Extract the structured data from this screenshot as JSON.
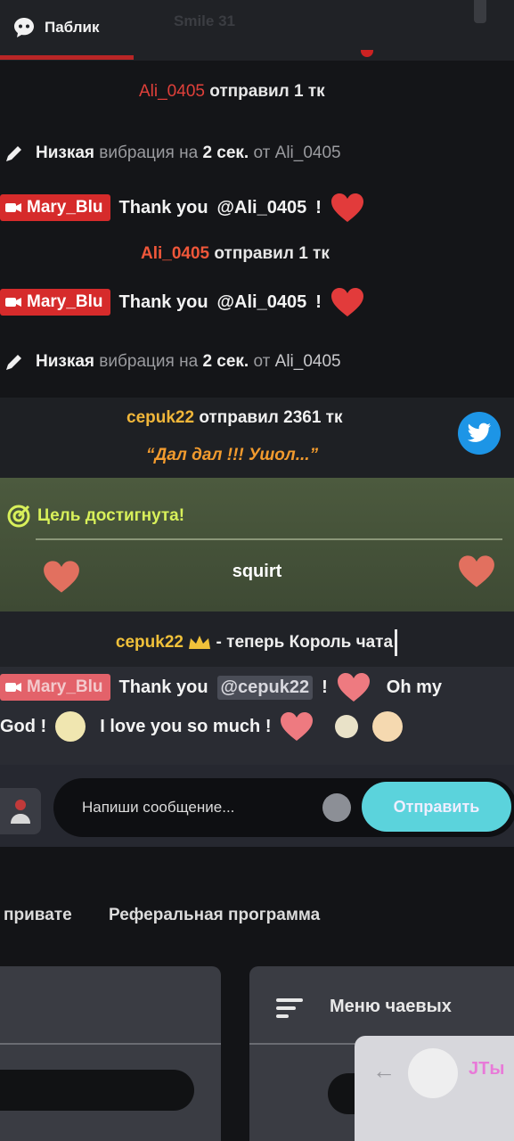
{
  "header": {
    "tab_public_label": "Паблик",
    "tab_ghost_label": "Smile 31"
  },
  "chat": {
    "tip_1": {
      "user": "Ali_0405",
      "text": "отправил 1 тк"
    },
    "vibration_1": {
      "level": "Низкая",
      "middle": "вибрация на",
      "duration": "2 сек.",
      "from": "от",
      "user": "Ali_0405"
    },
    "reply_1": {
      "badge": "Mary_Blu",
      "text": "Thank you",
      "mention": "@Ali_0405",
      "end": "!"
    },
    "tip_2": {
      "user": "Ali_0405",
      "text": "отправил 1 тк"
    },
    "reply_2": {
      "badge": "Mary_Blu",
      "text": "Thank you",
      "mention": "@Ali_0405",
      "end": "!"
    },
    "vibration_2": {
      "level": "Низкая",
      "middle": "вибрация на",
      "duration": "2 сек.",
      "from": "от",
      "user": "Ali_0405"
    }
  },
  "big_tip": {
    "user": "cepuk22",
    "text": "отправил 2361 тк",
    "quote": "“Дал дал !!! Ушол...”"
  },
  "goal": {
    "title": "Цель достигнута!",
    "label": "squirt"
  },
  "king": {
    "user": "cepuk22",
    "text": "- теперь Король чата"
  },
  "last_message": {
    "badge": "Mary_Blu",
    "text1": "Thank you",
    "mention": "@cepuk22",
    "end": "!",
    "text2": "Oh my",
    "line2_start": "God !",
    "line2_mid": "I love you so much !"
  },
  "composer": {
    "placeholder": "Напиши сообщение...",
    "send_label": "Отправить"
  },
  "bottom_nav": {
    "item1": "привате",
    "item2": "Реферальная программа",
    "tip_menu_label": "Меню чаевых",
    "popup_text": "JTы"
  },
  "colors": {
    "badge_red": "#d62b2b",
    "heart_red": "#e23b3b",
    "goal_green": "#4c5a3e",
    "goal_title": "#d8f05a",
    "send_cyan": "#5bd3dc",
    "twitter_blue": "#1d95e6"
  }
}
